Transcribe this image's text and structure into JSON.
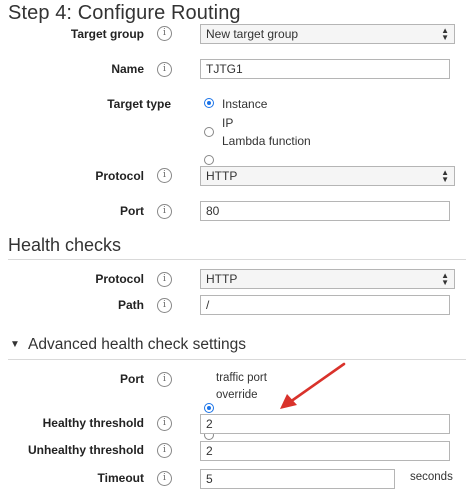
{
  "step_title": "Step 4: Configure Routing",
  "target_group": {
    "label": "Target group",
    "value": "New target group"
  },
  "name": {
    "label": "Name",
    "value": "TJTG1"
  },
  "target_type": {
    "label": "Target type",
    "options": [
      "Instance",
      "IP",
      "Lambda function"
    ],
    "selected": "Instance"
  },
  "protocol": {
    "label": "Protocol",
    "value": "HTTP"
  },
  "port": {
    "label": "Port",
    "value": "80"
  },
  "health_checks": {
    "title": "Health checks",
    "protocol_label": "Protocol",
    "protocol_value": "HTTP",
    "path_label": "Path",
    "path_value": "/"
  },
  "advanced": {
    "title": "Advanced health check settings",
    "port_label": "Port",
    "port_options": [
      "traffic port",
      "override"
    ],
    "port_selected": "traffic port",
    "healthy_label": "Healthy threshold",
    "healthy_value": "2",
    "unhealthy_label": "Unhealthy threshold",
    "unhealthy_value": "2",
    "timeout_label": "Timeout",
    "timeout_value": "5",
    "timeout_unit": "seconds"
  },
  "colors": {
    "accent": "#1a73e8",
    "annotation_arrow": "#d9322b"
  },
  "icons": {
    "info": "i"
  }
}
